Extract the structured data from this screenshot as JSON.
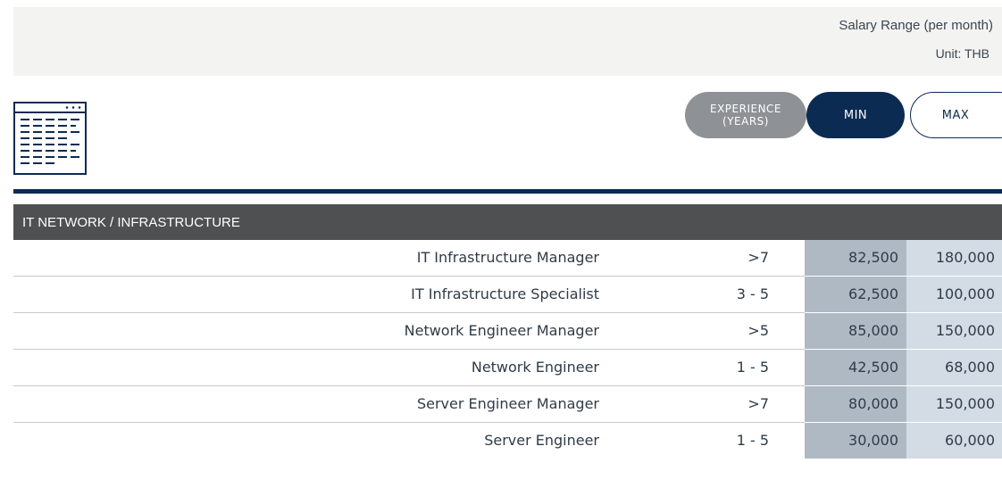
{
  "header": {
    "range_title": "Salary Range  (per month)",
    "unit": "Unit: THB"
  },
  "toggles": {
    "experience": "EXPERIENCE\n(YEARS)",
    "min": "MIN",
    "max": "MAX"
  },
  "icon": "document-list-icon",
  "section": {
    "title": "IT NETWORK / INFRASTRUCTURE"
  },
  "colors": {
    "navy": "#0c2b52",
    "section_bar": "#4f5052",
    "min_column": "#aeb9c4",
    "max_column": "#d3dce5",
    "pill_grey": "#8e9195"
  },
  "rows": [
    {
      "title": "IT Infrastructure Manager",
      "experience": ">7",
      "min": "82,500",
      "max": "180,000"
    },
    {
      "title": "IT Infrastructure Specialist",
      "experience": "3 - 5",
      "min": "62,500",
      "max": "100,000"
    },
    {
      "title": "Network Engineer Manager",
      "experience": ">5",
      "min": "85,000",
      "max": "150,000"
    },
    {
      "title": "Network Engineer",
      "experience": "1 - 5",
      "min": "42,500",
      "max": "68,000"
    },
    {
      "title": "Server Engineer Manager",
      "experience": ">7",
      "min": "80,000",
      "max": "150,000"
    },
    {
      "title": "Server Engineer",
      "experience": "1 - 5",
      "min": "30,000",
      "max": "60,000"
    }
  ]
}
